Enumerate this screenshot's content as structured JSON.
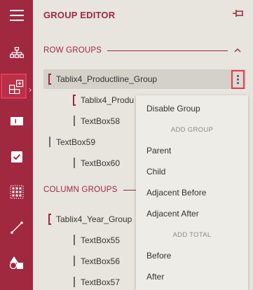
{
  "rail": {
    "items": [
      {
        "name": "menu-icon"
      },
      {
        "name": "hierarchy-icon"
      },
      {
        "name": "group-editor-icon"
      },
      {
        "name": "textbox-icon"
      },
      {
        "name": "checkbox-icon"
      },
      {
        "name": "grid-icon"
      },
      {
        "name": "line-icon"
      },
      {
        "name": "shapes-icon"
      }
    ],
    "accent": "#a0283f",
    "selected_index": 2
  },
  "panel": {
    "title": "GROUP EDITOR",
    "row_groups_label": "ROW GROUPS",
    "column_groups_label": "COLUMN GROUPS"
  },
  "tree": {
    "row": [
      {
        "label": "Tablix4_Productline_Group"
      },
      {
        "label": "Tablix4_Produ"
      },
      {
        "label": "TextBox58"
      },
      {
        "label": "TextBox59"
      },
      {
        "label": "TextBox60"
      }
    ],
    "column": [
      {
        "label": "Tablix4_Year_Group"
      },
      {
        "label": "TextBox55"
      },
      {
        "label": "TextBox56"
      },
      {
        "label": "TextBox57"
      }
    ]
  },
  "menu": {
    "disable": "Disable Group",
    "add_group_head": "ADD GROUP",
    "parent": "Parent",
    "child": "Child",
    "adjacent_before": "Adjacent Before",
    "adjacent_after": "Adjacent After",
    "add_total_head": "ADD TOTAL",
    "before": "Before",
    "after": "After"
  }
}
